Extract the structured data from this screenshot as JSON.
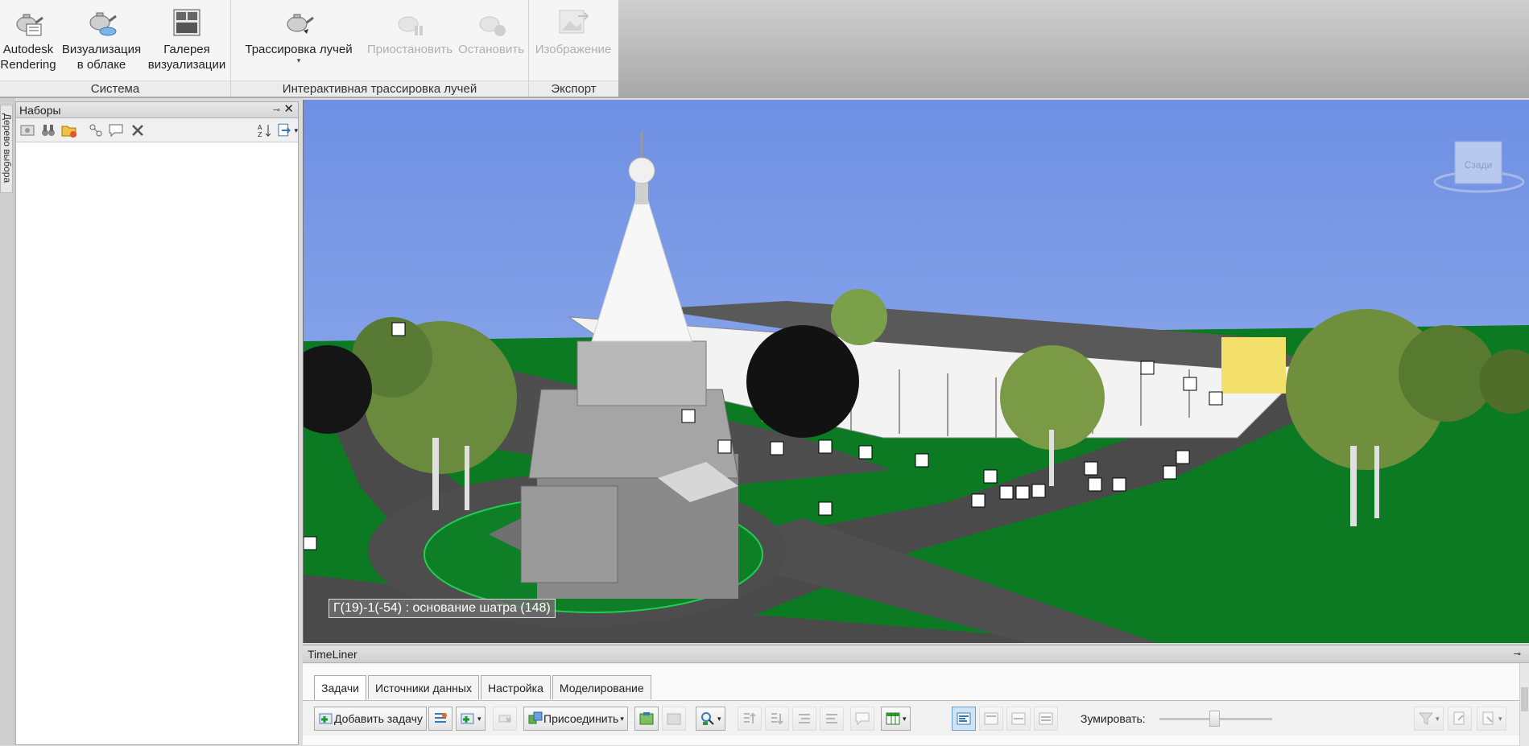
{
  "ribbon": {
    "groups": [
      {
        "label": "Система",
        "buttons": [
          {
            "label": "Autodesk\nRendering",
            "icon": "teapot-rendering-icon"
          },
          {
            "label": "Визуализация\nв облаке",
            "icon": "teapot-cloud-icon"
          },
          {
            "label": "Галерея\nвизуализации",
            "icon": "gallery-icon"
          }
        ]
      },
      {
        "label": "Интерактивная трассировка лучей",
        "buttons": [
          {
            "label": "Трассировка лучей",
            "icon": "raytrace-teapot-icon"
          },
          {
            "label": "Приостановить",
            "icon": "pause-teapot-icon",
            "disabled": true
          },
          {
            "label": "Остановить",
            "icon": "stop-teapot-icon",
            "disabled": true
          }
        ]
      },
      {
        "label": "Экспорт",
        "buttons": [
          {
            "label": "Изображение",
            "icon": "image-export-icon",
            "disabled": true
          }
        ]
      }
    ]
  },
  "side_tab": {
    "label": "Дерево выбора"
  },
  "sets_panel": {
    "title": "Наборы",
    "pin": "⊸",
    "close": "✕"
  },
  "viewport": {
    "tooltip": "Г(19)-1(-54) : основание шатра (148)",
    "viewcube_label": "Сзади"
  },
  "timeliner": {
    "title": "TimeLiner",
    "tabs": [
      "Задачи",
      "Источники данных",
      "Настройка",
      "Моделирование"
    ],
    "add_task": "Добавить задачу",
    "attach": "Присоединить",
    "zoom_label": "Зумировать:"
  },
  "colors": {
    "sky": "#6f94e4",
    "grass": "#0b7a22",
    "road": "#4f4f4f",
    "tree": "#5c7a3a",
    "building": "#f2f2f2"
  }
}
